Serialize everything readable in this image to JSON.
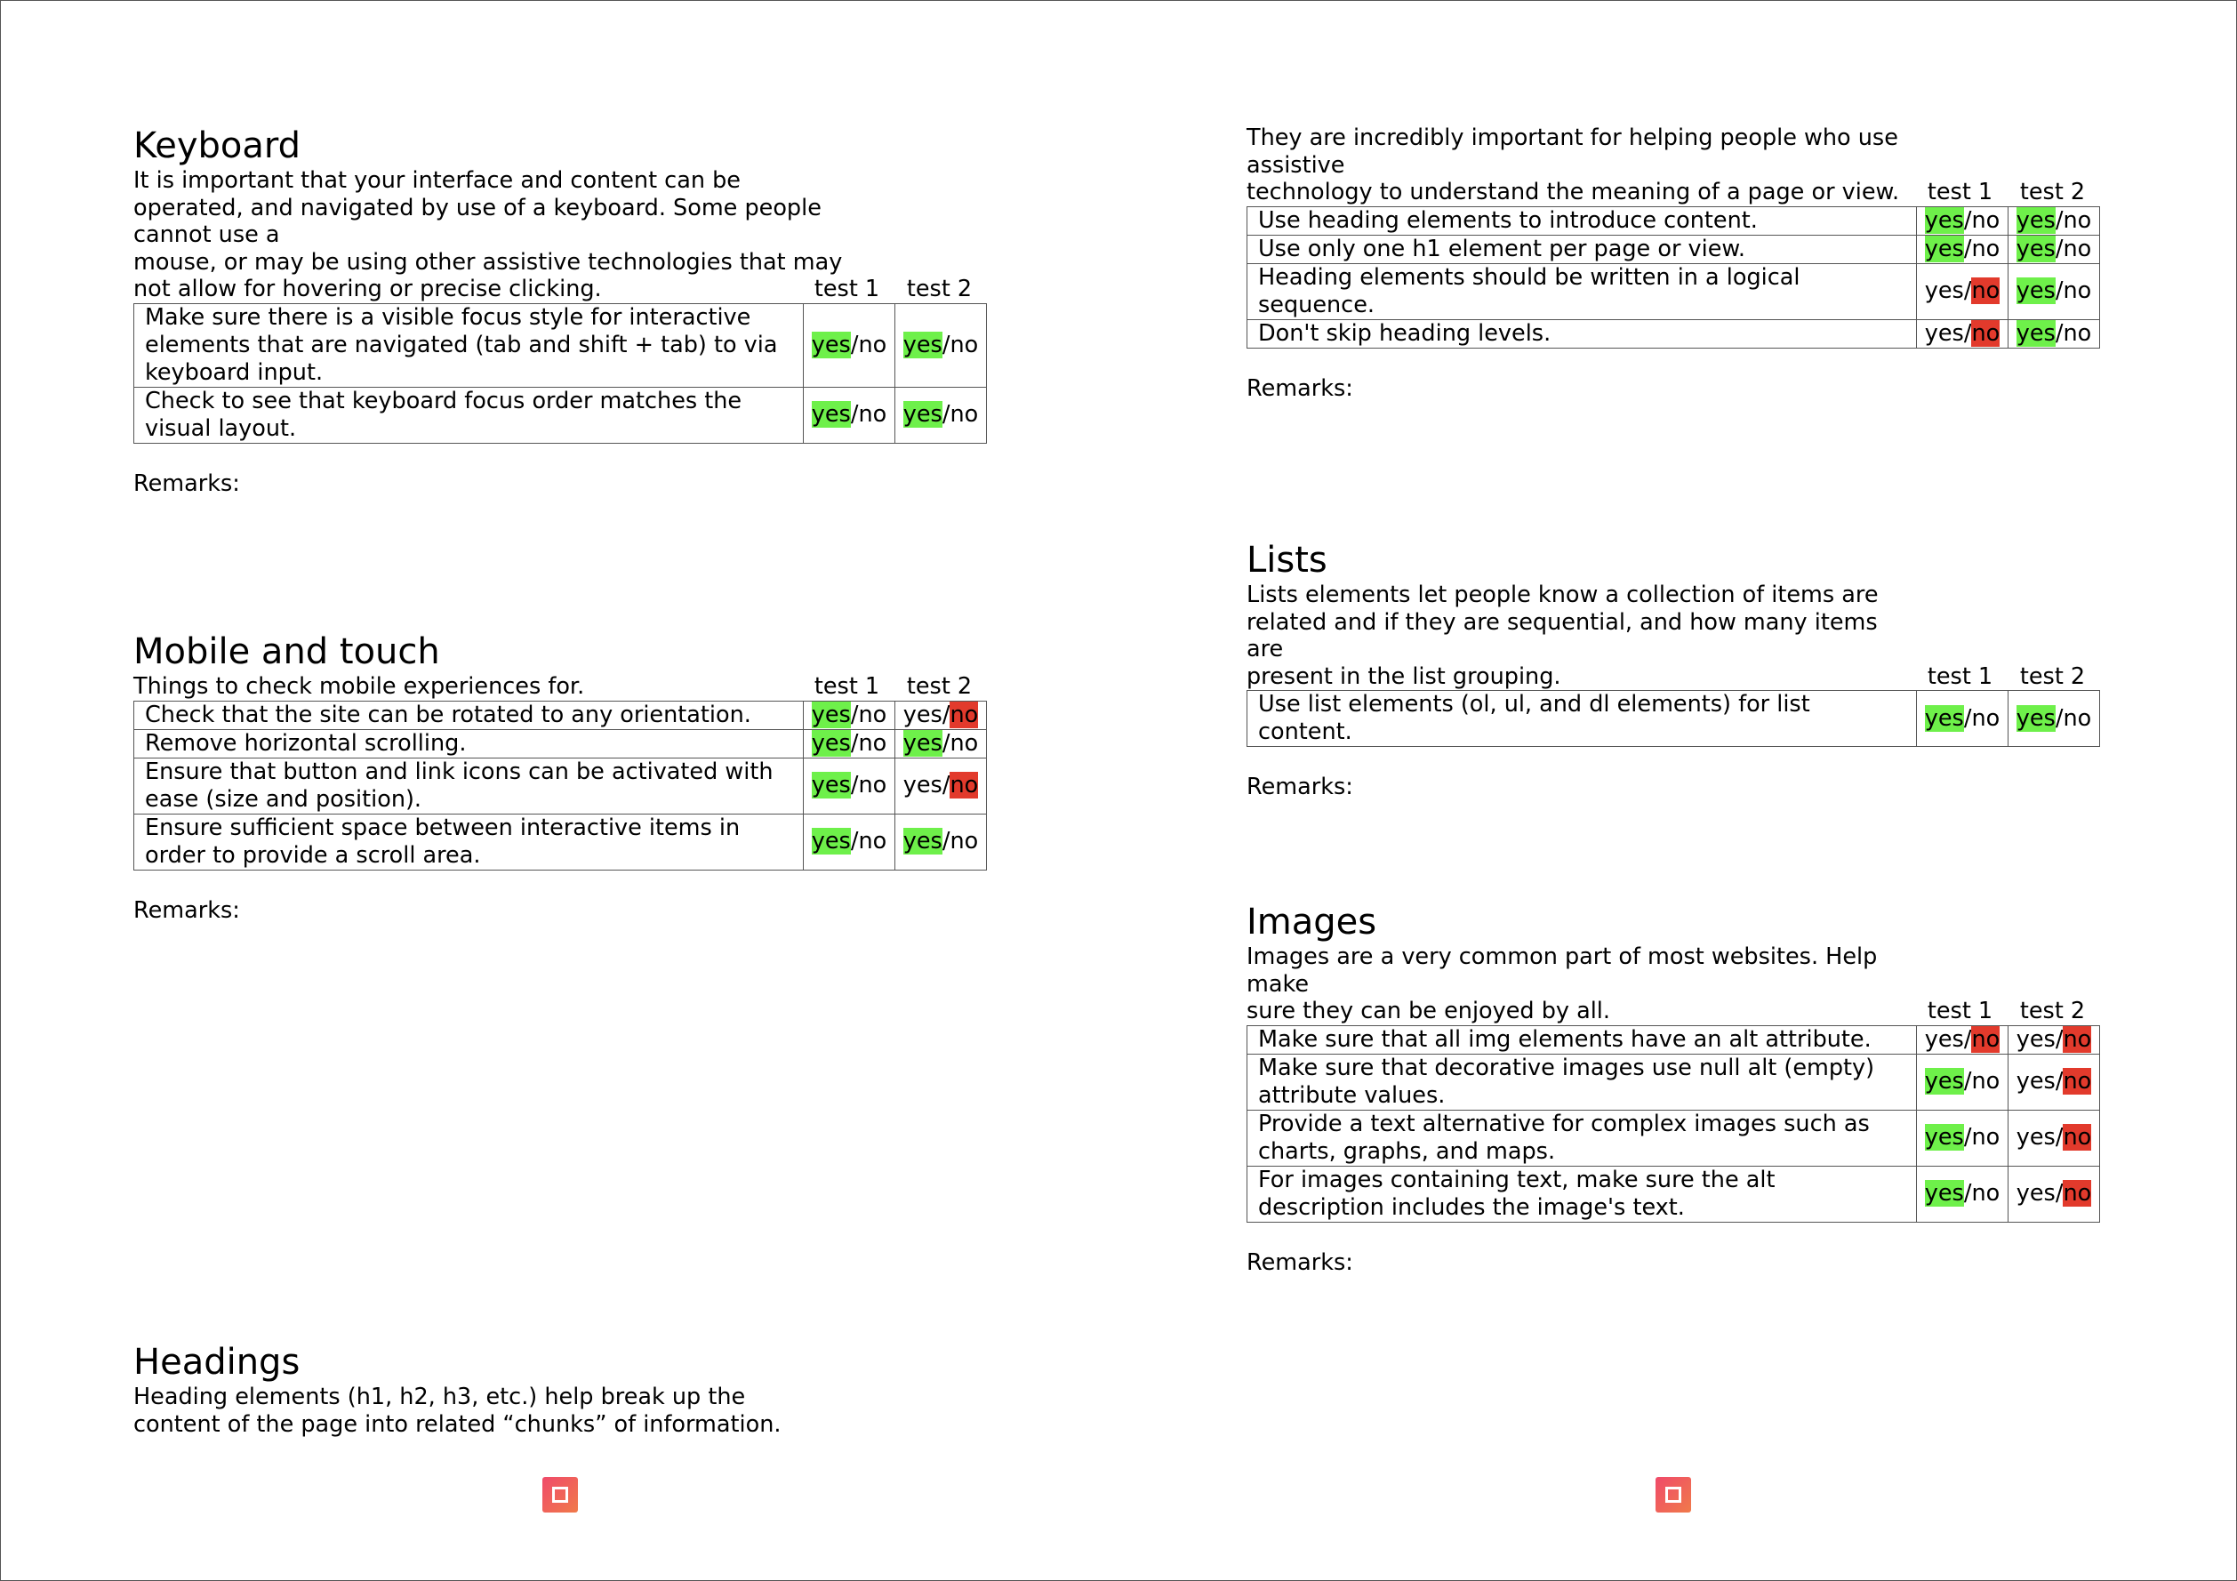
{
  "left": {
    "keyboard": {
      "title": "Keyboard",
      "intro": "It is important that your interface and content can be\noperated, and navigated by use of a keyboard. Some people\ncannot use a\nmouse, or may be using other assistive technologies that may\nnot allow for hovering or precise clicking.",
      "test1": "test 1",
      "test2": "test 2",
      "rows": [
        {
          "text": "Make sure there is a visible focus style for interactive elements that are navigated (tab and shift + tab) to via keyboard input.",
          "t1": "yes",
          "t2": "yes"
        },
        {
          "text": "Check to see that keyboard focus order matches the visual layout.",
          "t1": "yes",
          "t2": "yes"
        }
      ],
      "remarks": "Remarks:"
    },
    "mobile": {
      "title": "Mobile and touch",
      "intro": "Things to check mobile experiences for.",
      "test1": "test 1",
      "test2": "test 2",
      "rows": [
        {
          "text": "Check that the site can be rotated to any orientation.",
          "t1": "yes",
          "t2": "no"
        },
        {
          "text": "Remove horizontal scrolling.",
          "t1": "yes",
          "t2": "yes"
        },
        {
          "text": "Ensure that button and link icons can be activated with ease (size and position).",
          "t1": "yes",
          "t2": "no"
        },
        {
          "text": "Ensure sufficient space between interactive items in order to provide a scroll area.",
          "t1": "yes",
          "t2": "yes"
        }
      ],
      "remarks": "Remarks:"
    },
    "headings": {
      "title": "Headings",
      "intro": "Heading elements (h1, h2, h3, etc.) help break up the\ncontent of the page into related “chunks” of information."
    }
  },
  "right": {
    "headings_cont": {
      "intro": "They are incredibly important for helping people who use\nassistive\ntechnology to understand the meaning of a page or view.",
      "test1": "test 1",
      "test2": "test 2",
      "rows": [
        {
          "text": "Use heading elements to introduce content.",
          "t1": "yes",
          "t2": "yes"
        },
        {
          "text": "Use only one h1 element per page or view.",
          "t1": "yes",
          "t2": "yes"
        },
        {
          "text": "Heading elements should be written in a logical sequence.",
          "t1": "no",
          "t2": "yes"
        },
        {
          "text": "Don't skip heading levels.",
          "t1": "no",
          "t2": "yes"
        }
      ],
      "remarks": "Remarks:"
    },
    "lists": {
      "title": "Lists",
      "intro": "Lists elements let people know a collection of items are\nrelated and if they are sequential, and how many items\nare\npresent in the list grouping.",
      "test1": "test 1",
      "test2": "test 2",
      "rows": [
        {
          "text": "Use list elements (ol, ul, and dl elements) for list content.",
          "t1": "yes",
          "t2": "yes"
        }
      ],
      "remarks": "Remarks:"
    },
    "images": {
      "title": "Images",
      "intro": "Images are a very common part of most websites. Help make\nsure they can be enjoyed by all.",
      "test1": "test 1",
      "test2": "test 2",
      "rows": [
        {
          "text": "Make sure that all img elements have an alt attribute.",
          "t1": "no",
          "t2": "no"
        },
        {
          "text": "Make sure that decorative images use null alt (empty) attribute values.",
          "t1": "yes",
          "t2": "no"
        },
        {
          "text": "Provide a text alternative for complex images such as charts, graphs, and maps.",
          "t1": "yes",
          "t2": "no"
        },
        {
          "text": "For images containing text, make sure the alt description includes the image's text.",
          "t1": "yes",
          "t2": "no"
        }
      ],
      "remarks": "Remarks:"
    }
  },
  "labels": {
    "yes": "yes",
    "sep": "/",
    "no": "no"
  },
  "colors": {
    "yes_highlight": "#6ef04a",
    "no_highlight": "#e23a2c",
    "footer_icon": "#f05a60"
  },
  "icons": {
    "footer": "page-logo-icon"
  }
}
